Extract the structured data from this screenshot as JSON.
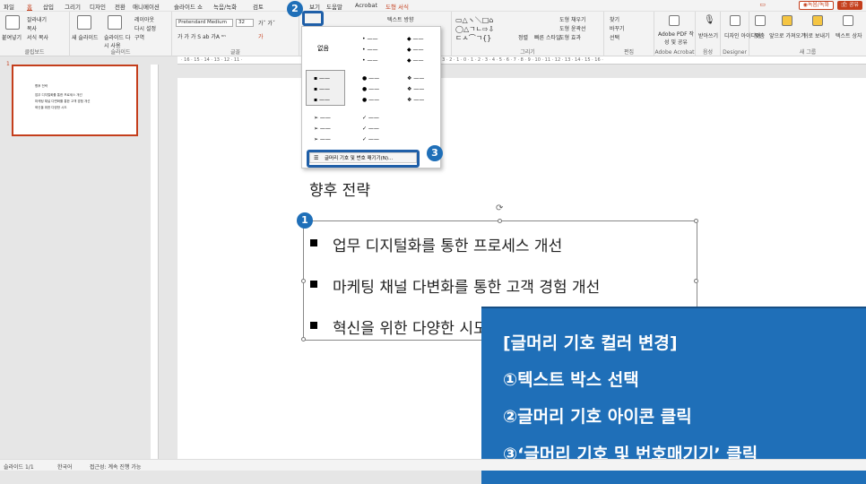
{
  "menu": [
    "파일",
    "홈",
    "삽입",
    "그리기",
    "디자인",
    "전환",
    "애니메이션",
    "슬라이드 쇼",
    "녹음/녹화",
    "검토",
    "보기",
    "도움말",
    "Acrobat",
    "도형 서식"
  ],
  "top_right": {
    "record": "◉녹음/녹화",
    "share": "🖆 공유"
  },
  "ribbon": {
    "clipboard": {
      "label": "클립보드",
      "paste": "붙여넣기",
      "cut": "잘라내기",
      "copy": "복사",
      "format": "서식 복사"
    },
    "slides": {
      "label": "슬라이드",
      "new": "새 슬라이드",
      "reuse": "슬라이드 다시 사용",
      "layout": "레이아웃",
      "reset": "다시 설정",
      "section": "구역"
    },
    "font": {
      "label": "글꼴",
      "name": "Pretendard Medium",
      "size": "32"
    },
    "paragraph": {
      "text_dir": "텍스트 방향"
    },
    "drawing": {
      "label": "그리기",
      "arrange": "정렬",
      "quick": "빠른 스타일",
      "fill": "도형 채우기",
      "outline": "도형 윤곽선",
      "effect": "도형 효과"
    },
    "editing": {
      "label": "편집",
      "find": "찾기",
      "replace": "바꾸기",
      "select": "선택"
    },
    "acrobat": {
      "label": "Adobe Acrobat",
      "pdf": "Adobe PDF 작성 및 공유"
    },
    "voice": {
      "label": "음성",
      "dictate": "받아쓰기"
    },
    "designer": {
      "label": "Designer",
      "design": "디자인 아이디어"
    },
    "new_group": {
      "label": "새 그룹",
      "align": "맞춤",
      "front": "앞으로 가져오기",
      "back": "뒤로 보내기",
      "textbox": "텍스트 상자"
    }
  },
  "dropdown": {
    "none_label": "없음",
    "footer": "글머리 기호 및 번호 매기기(N)..."
  },
  "thumbnail": {
    "number": "1",
    "title": "향후 전략",
    "items": [
      "업무 디지털화를 통한 프로세스 개선",
      "마케팅 채널 다변화를 통한 고객 경험 개선",
      "혁신을 위한 다양한 시도"
    ]
  },
  "slide": {
    "title": "향후 전략",
    "bullets": [
      "업무 디지털화를 통한 프로세스 개선",
      "마케팅 채널 다변화를 통한 고객 경험 개선",
      "혁신을 위한 다양한 시도"
    ]
  },
  "callout": {
    "lines": [
      "[글머리 기호 컬러 변경]",
      "①텍스트 박스 선택",
      "②글머리 기호 아이콘 클릭",
      "③‘글머리 기호 및 번호매기기’ 클릭"
    ]
  },
  "markers": [
    "1",
    "2",
    "3"
  ],
  "status": {
    "slide": "슬라이드 1/1",
    "lang": "한국어",
    "access": "접근성: 계속 진행 가능"
  },
  "colors": {
    "accent": "#c43e1c",
    "callout": "#1f6fb8",
    "marker": "#1f5fa8"
  }
}
